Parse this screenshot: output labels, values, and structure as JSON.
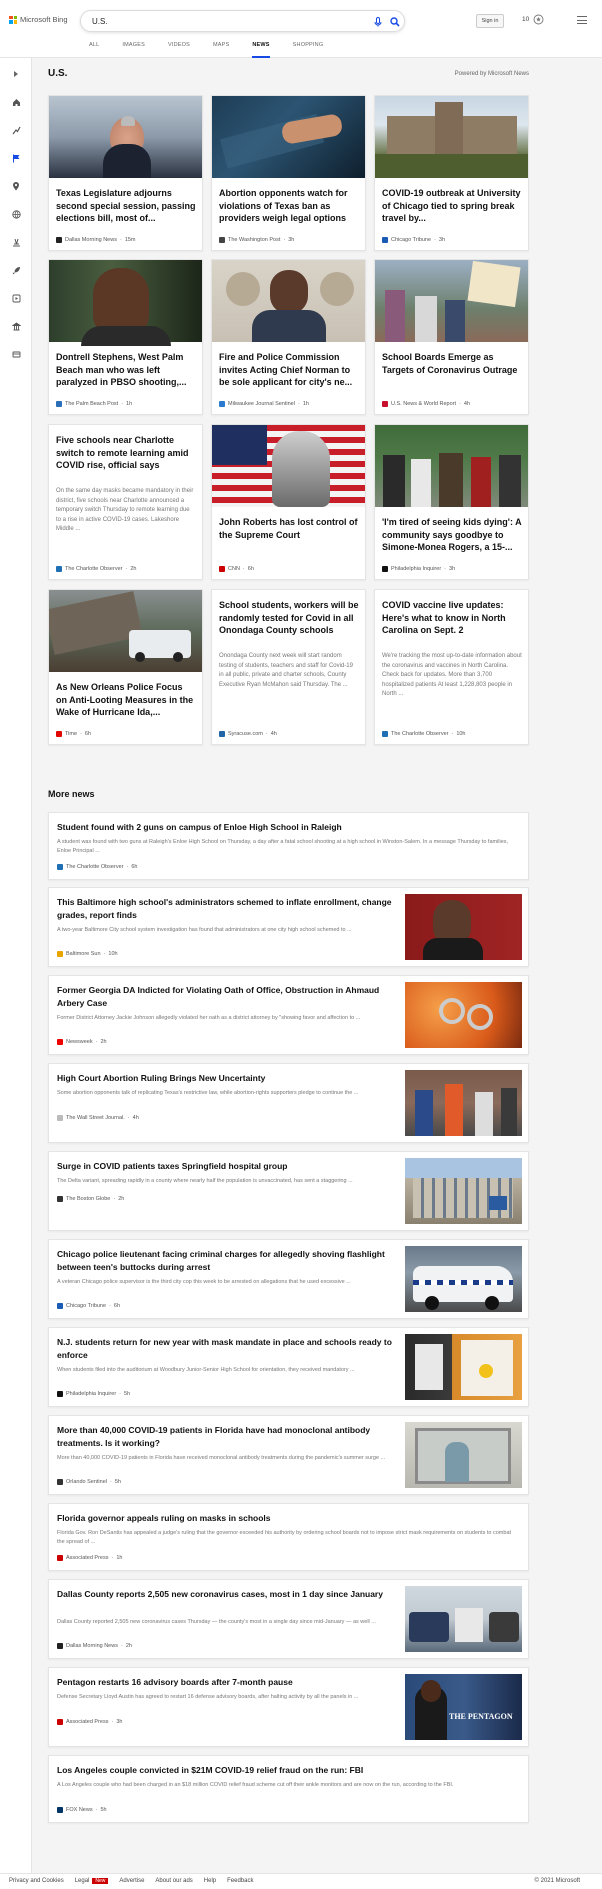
{
  "brand": {
    "name": "Microsoft Bing"
  },
  "search": {
    "value": "U.S."
  },
  "header": {
    "signin": "Sign in",
    "rewards": "10"
  },
  "nav_tabs": [
    {
      "label": "ALL"
    },
    {
      "label": "IMAGES"
    },
    {
      "label": "VIDEOS"
    },
    {
      "label": "MAPS"
    },
    {
      "label": "NEWS",
      "active": true
    },
    {
      "label": "SHOPPING"
    }
  ],
  "section": {
    "title": "U.S.",
    "powered": "Powered by Microsoft News"
  },
  "cards": [
    {
      "title": "Texas Legislature adjourns second special session, passing elections bill, most of...",
      "source": "Dallas Morning News",
      "age": "15m",
      "fav": "#222",
      "img": "politician"
    },
    {
      "title": "Abortion opponents watch for violations of Texas ban as providers weigh legal options",
      "source": "The Washington Post",
      "age": "3h",
      "fav": "#444",
      "img": "hands"
    },
    {
      "title": "COVID-19 outbreak at University of Chicago tied to spring break travel by...",
      "source": "Chicago Tribune",
      "age": "3h",
      "fav": "#1a5bb5",
      "img": "campus"
    },
    {
      "title": "Dontrell Stephens, West Palm Beach man who was left paralyzed in PBSO shooting,...",
      "source": "The Palm Beach Post",
      "age": "1h",
      "fav": "#2a6db8",
      "img": "man"
    },
    {
      "title": "Fire and Police Commission invites Acting Chief Norman to be sole applicant for city's ne...",
      "source": "Milwaukee Journal Sentinel",
      "age": "1h",
      "fav": "#2a7bd0",
      "img": "officer"
    },
    {
      "title": "School Boards Emerge as Targets of Coronavirus Outrage",
      "source": "U.S. News & World Report",
      "age": "4h",
      "fav": "#c8102e",
      "img": "protest"
    },
    {
      "title": "Five schools near Charlotte switch to remote learning amid COVID rise, official says",
      "snippet": "On the same day masks became mandatory in their district, five schools near Charlotte announced a temporary switch Thursday to remote learning due to a rise in active COVID-19 cases. Lakeshore Middle ...",
      "source": "The Charlotte Observer",
      "age": "2h",
      "fav": "#1f6fb5"
    },
    {
      "title": "John Roberts has lost control of the Supreme Court",
      "source": "CNN",
      "age": "6h",
      "fav": "#cc0000",
      "img": "flag"
    },
    {
      "title": "'I'm tired of seeing kids dying': A community says goodbye to Simone-Monea Rogers, a 15-...",
      "source": "Philadelphia Inquirer",
      "age": "3h",
      "fav": "#111",
      "img": "crowd"
    },
    {
      "title": "As New Orleans Police Focus on Anti-Looting Measures in the Wake of Hurricane Ida,...",
      "source": "Time",
      "age": "6h",
      "fav": "#e10600",
      "img": "storm"
    },
    {
      "title": "School students, workers will be randomly tested for Covid in all Onondaga County schools",
      "snippet": "Onondaga County next week will start random testing of students, teachers and staff for Covid-19 in all public, private and charter schools, County Executive Ryan McMahon said Thursday. The ...",
      "source": "Syracuse.com",
      "age": "4h",
      "fav": "#2266aa"
    },
    {
      "title": "COVID vaccine live updates: Here's what to know in North Carolina on Sept. 2",
      "snippet": "We're tracking the most up-to-date information about the coronavirus and vaccines in North Carolina. Check back for updates. More than 3,700 hospitalized patients At least 1,228,803 people in North ...",
      "source": "The Charlotte Observer",
      "age": "10h",
      "fav": "#1f6fb5"
    }
  ],
  "more_news": {
    "title": "More news"
  },
  "rows": [
    {
      "title": "Student found with 2 guns on campus of Enloe High School in Raleigh",
      "snippet": "A student was found with two guns at Raleigh's Enloe High School on Thursday, a day after a fatal school shooting at a high school in Winston-Salem. In a message Thursday to families, Enloe Principal ...",
      "source": "The Charlotte Observer",
      "age": "6h",
      "fav": "#1f6fb5"
    },
    {
      "title": "This Baltimore high school's administrators schemed to inflate enrollment, change grades, report finds",
      "snippet": "A two-year Baltimore City school system investigation has found that administrators at one city high school schemed to ...",
      "source": "Baltimore Sun",
      "age": "10h",
      "fav": "#e8a400",
      "img": "woman"
    },
    {
      "title": "Former Georgia DA Indicted for Violating Oath of Office, Obstruction in Ahmaud Arbery Case",
      "snippet": "Former District Attorney Jackie Johnson allegedly violated her oath as a district attorney by \"showing favor and affection to ...",
      "source": "Newsweek",
      "age": "2h",
      "fav": "#e00",
      "img": "cuffs"
    },
    {
      "title": "High Court Abortion Ruling Brings New Uncertainty",
      "snippet": "Some abortion opponents talk of replicating Texas's restrictive law, while abortion-rights supporters pledge to continue the ...",
      "source": "The Wall Street Journal.",
      "age": "4h",
      "fav": "#bbb",
      "img": "rally"
    },
    {
      "title": "Surge in COVID patients taxes Springfield hospital group",
      "snippet": "The Delta variant, spreading rapidly in a county where nearly half the population is unvaccinated, has sent a staggering ...",
      "source": "The Boston Globe",
      "age": "2h",
      "fav": "#333",
      "img": "hospital"
    },
    {
      "title": "Chicago police lieutenant facing criminal charges for allegedly shoving flashlight between teen's buttocks during arrest",
      "snippet": "A veteran Chicago police supervisor is the third city cop this week to be arrested on allegations that he used excessive ...",
      "source": "Chicago Tribune",
      "age": "6h",
      "fav": "#1a5bb5",
      "img": "police"
    },
    {
      "title": "N.J. students return for new year with mask mandate in place and schools ready to enforce",
      "snippet": "When students filed into the auditorium at Woodbury Junior-Senior High School for orientation, they received mandatory ...",
      "source": "Philadelphia Inquirer",
      "age": "5h",
      "fav": "#111",
      "img": "signs"
    },
    {
      "title": "More than 40,000 COVID-19 patients in Florida have had monoclonal antibody treatments. Is it working?",
      "snippet": "More than 40,000 COVID-19 patients in Florida have received monoclonal antibody treatments during the pandemic's summer surge ...",
      "source": "Orlando Sentinel",
      "age": "5h",
      "fav": "#333",
      "img": "clinic"
    },
    {
      "title": "Florida governor appeals ruling on masks in schools",
      "snippet": "Florida Gov. Ron DeSantis has appealed a judge's ruling that the governor exceeded his authority by ordering school boards not to impose strict mask requirements on students to combat the spread of ...",
      "source": "Associated Press",
      "age": "1h",
      "fav": "#c00"
    },
    {
      "title": "Dallas County reports 2,505 new coronavirus cases, most in 1 day since January",
      "snippet": "Dallas County reported 2,505 new coronavirus cases Thursday — the county's most in a single day since mid-January — as well ...",
      "source": "Dallas Morning News",
      "age": "2h",
      "fav": "#222",
      "img": "testing"
    },
    {
      "title": "Pentagon restarts 16 advisory boards after 7-month pause",
      "snippet": "Defense Secretary Lloyd Austin has agreed to restart 16 defense advisory boards, after halting activity by all the panels in ...",
      "source": "Associated Press",
      "age": "3h",
      "fav": "#c00",
      "img": "pentagon",
      "img_text": "THE PENTAGON"
    },
    {
      "title": "Los Angeles couple convicted in $21M COVID-19 relief fraud on the run: FBI",
      "snippet": "A Los Angeles couple who had been charged in an $18 million COVID relief fraud scheme cut off their ankle monitors and are now on the run, according to the FBI.",
      "source": "FOX News",
      "age": "5h",
      "fav": "#003366"
    }
  ],
  "footer": {
    "links": [
      "Privacy and Cookies",
      "Legal",
      "Advertise",
      "About our ads",
      "Help",
      "Feedback"
    ],
    "new_badge": "New",
    "copyright": "© 2021 Microsoft"
  },
  "colors": {
    "accent": "#174ae4",
    "ms_red": "#f25022",
    "ms_green": "#7fba00",
    "ms_blue": "#00a4ef",
    "ms_yellow": "#ffb900"
  }
}
